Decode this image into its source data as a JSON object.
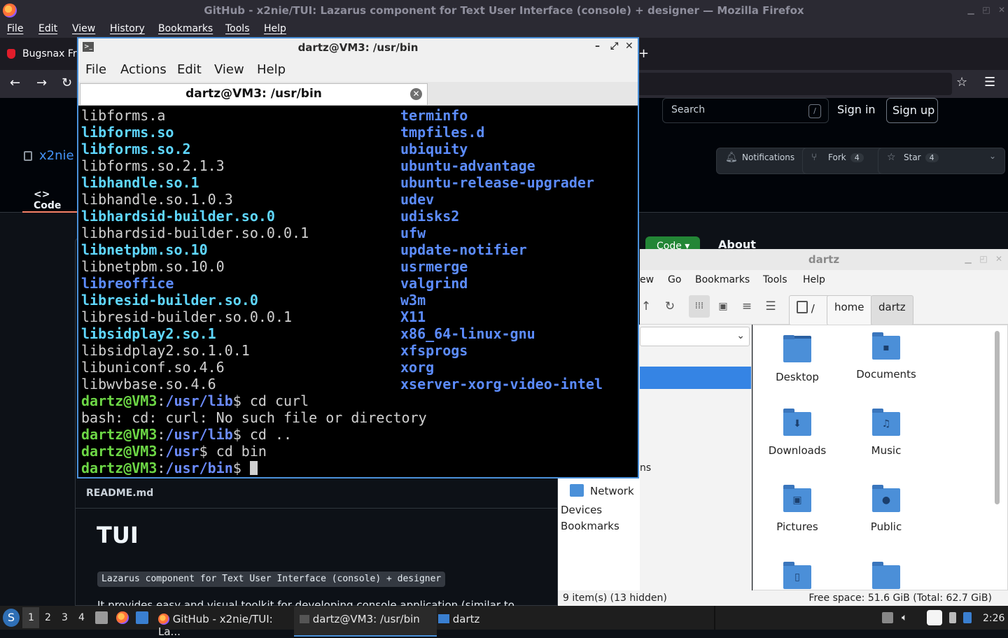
{
  "firefox": {
    "window_title": "GitHub - x2nie/TUI: Lazarus component for Text User Interface (console) + designer — Mozilla Firefox",
    "menu": [
      "File",
      "Edit",
      "View",
      "History",
      "Bookmarks",
      "Tools",
      "Help"
    ],
    "tab_label": "Bugsnax Fre",
    "new_tab": "+"
  },
  "github": {
    "search_placeholder": "Search",
    "search_key": "/",
    "sign_in": "Sign in",
    "sign_up": "Sign up",
    "repo_owner": "x2nie",
    "notifications": "Notifications",
    "fork_label": "Fork",
    "fork_count": "4",
    "star_label": "Star",
    "star_count": "4",
    "code_tab": "Code",
    "code_button": "Code",
    "about": "About",
    "readme_label": "README.md",
    "readme_title": "TUI",
    "readme_code": "Lazarus component for Text User Interface (console) + designer",
    "readme_para": "It provides easy and visual toolkit for developing console application (similar to TurboVision / I"
  },
  "terminal": {
    "window_title": "dartz@VM3: /usr/bin",
    "menu": [
      "File",
      "Actions",
      "Edit",
      "View",
      "Help"
    ],
    "tab_title": "dartz@VM3: /usr/bin",
    "left_column": [
      {
        "text": "libforms.a",
        "style": "reg"
      },
      {
        "text": "libforms.so",
        "style": "lnk"
      },
      {
        "text": "libforms.so.2",
        "style": "lnk"
      },
      {
        "text": "libforms.so.2.1.3",
        "style": "reg"
      },
      {
        "text": "libhandle.so.1",
        "style": "lnk"
      },
      {
        "text": "libhandle.so.1.0.3",
        "style": "reg"
      },
      {
        "text": "libhardsid-builder.so.0",
        "style": "lnk"
      },
      {
        "text": "libhardsid-builder.so.0.0.1",
        "style": "reg"
      },
      {
        "text": "libnetpbm.so.10",
        "style": "lnk"
      },
      {
        "text": "libnetpbm.so.10.0",
        "style": "reg"
      },
      {
        "text": "libreoffice",
        "style": "dir"
      },
      {
        "text": "libresid-builder.so.0",
        "style": "lnk"
      },
      {
        "text": "libresid-builder.so.0.0.1",
        "style": "reg"
      },
      {
        "text": "libsidplay2.so.1",
        "style": "lnk"
      },
      {
        "text": "libsidplay2.so.1.0.1",
        "style": "reg"
      },
      {
        "text": "libuniconf.so.4.6",
        "style": "reg"
      },
      {
        "text": "libwvbase.so.4.6",
        "style": "reg"
      }
    ],
    "right_column": [
      {
        "text": "terminfo",
        "style": "dir"
      },
      {
        "text": "tmpfiles.d",
        "style": "dir"
      },
      {
        "text": "ubiquity",
        "style": "dir"
      },
      {
        "text": "ubuntu-advantage",
        "style": "dir"
      },
      {
        "text": "ubuntu-release-upgrader",
        "style": "dir"
      },
      {
        "text": "udev",
        "style": "dir"
      },
      {
        "text": "udisks2",
        "style": "dir"
      },
      {
        "text": "ufw",
        "style": "dir"
      },
      {
        "text": "update-notifier",
        "style": "dir"
      },
      {
        "text": "usrmerge",
        "style": "dir"
      },
      {
        "text": "valgrind",
        "style": "dir"
      },
      {
        "text": "w3m",
        "style": "dir"
      },
      {
        "text": "X11",
        "style": "dir"
      },
      {
        "text": "x86_64-linux-gnu",
        "style": "dir"
      },
      {
        "text": "xfsprogs",
        "style": "dir"
      },
      {
        "text": "xorg",
        "style": "dir"
      },
      {
        "text": "xserver-xorg-video-intel",
        "style": "dir"
      }
    ],
    "session": [
      {
        "user": "dartz@VM3",
        "sep": ":",
        "path": "/usr/lib",
        "sigil": "$ ",
        "cmd": "cd curl"
      },
      {
        "output": "bash: cd: curl: No such file or directory"
      },
      {
        "user": "dartz@VM3",
        "sep": ":",
        "path": "/usr/lib",
        "sigil": "$ ",
        "cmd": "cd .."
      },
      {
        "user": "dartz@VM3",
        "sep": ":",
        "path": "/usr",
        "sigil": "$ ",
        "cmd": "cd bin"
      },
      {
        "user": "dartz@VM3",
        "sep": ":",
        "path": "/usr/bin",
        "sigil": "$ ",
        "cmd": ""
      }
    ]
  },
  "filemanager": {
    "window_title": "dartz",
    "menu": [
      "ew",
      "Go",
      "Bookmarks",
      "Tools",
      "Help"
    ],
    "path_root": "/",
    "path_home": "home",
    "path_user": "dartz",
    "side_partial": "ns",
    "network": "Network",
    "devices": "Devices",
    "bookmarks": "Bookmarks",
    "items": [
      {
        "label": "Desktop",
        "icon": "desktop-folder-icon",
        "glyph": ""
      },
      {
        "label": "Documents",
        "icon": "documents-folder-icon",
        "glyph": "▪"
      },
      {
        "label": "Downloads",
        "icon": "downloads-folder-icon",
        "glyph": "⬇"
      },
      {
        "label": "Music",
        "icon": "music-folder-icon",
        "glyph": "♫"
      },
      {
        "label": "Pictures",
        "icon": "pictures-folder-icon",
        "glyph": "▣"
      },
      {
        "label": "Public",
        "icon": "public-folder-icon",
        "glyph": "●"
      },
      {
        "label": "",
        "icon": "templates-folder-icon",
        "glyph": "▯"
      },
      {
        "label": "",
        "icon": "videos-folder-icon",
        "glyph": ""
      }
    ],
    "status_items": "9 item(s) (13 hidden)",
    "status_space": "Free space: 51.6 GiB (Total: 62.7 GiB)"
  },
  "taskbar": {
    "desktops": [
      "1",
      "2",
      "3",
      "4"
    ],
    "tasks": [
      {
        "label": "GitHub - x2nie/TUI: La..."
      },
      {
        "label": "dartz@VM3: /usr/bin"
      },
      {
        "label": "dartz"
      }
    ],
    "clock": "2:26"
  }
}
